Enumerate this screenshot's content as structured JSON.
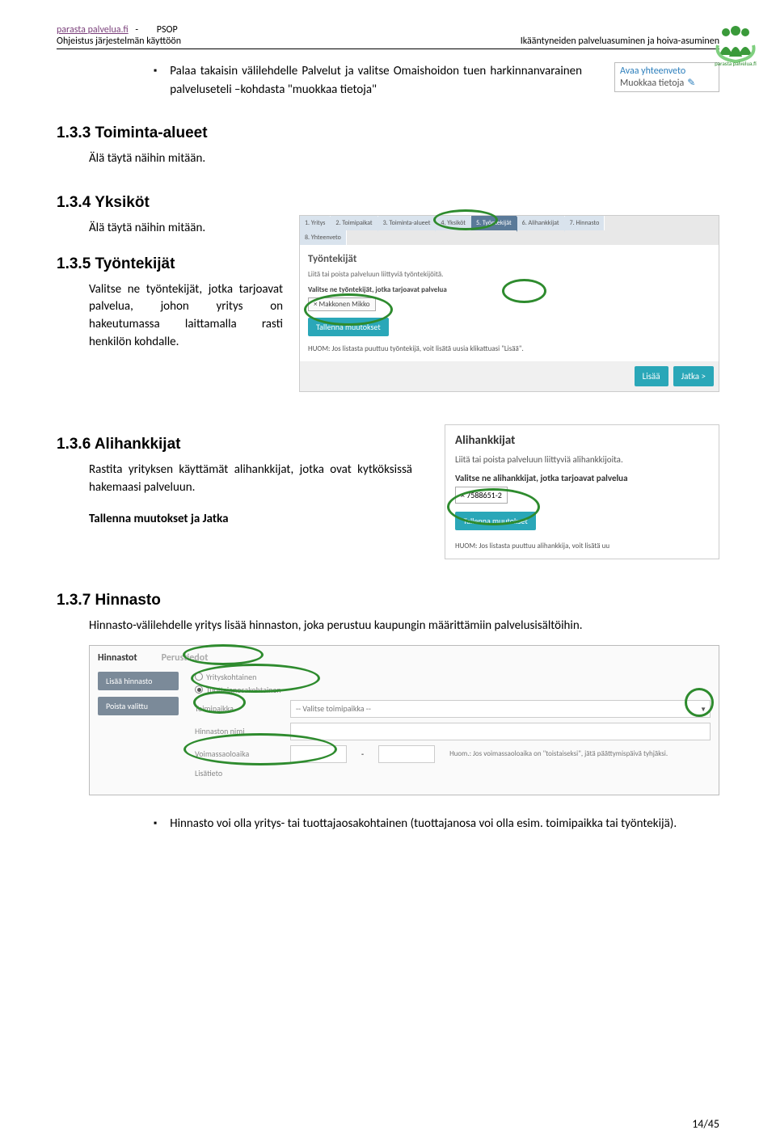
{
  "header": {
    "site": "parasta palvelua.fi",
    "dash": "-",
    "psop": "PSOP",
    "line2": "Ohjeistus järjestelmän käyttöön",
    "right": "Ikääntyneiden palveluasuminen ja hoiva-asuminen"
  },
  "logo_text": "parasta palvelua.fi",
  "bullet1": "Palaa takaisin välilehdelle Palvelut ja valitse Omaishoidon tuen harkinnanvarainen palveluseteli –kohdasta \"muokkaa tietoja\"",
  "popup": {
    "l1": "Avaa yhteenveto",
    "l2": "Muokkaa tietoja"
  },
  "s133": {
    "h": "1.3.3 Toiminta-alueet",
    "p": "Älä täytä näihin mitään."
  },
  "s134": {
    "h": "1.3.4 Yksiköt",
    "p": "Älä täytä näihin mitään."
  },
  "s135": {
    "h": "1.3.5 Työntekijät",
    "p": "Valitse ne työntekijät, jotka tarjoavat palvelua, johon yritys on hakeutumassa laittamalla rasti henkilön kohdalle."
  },
  "shot_t": {
    "tabs": [
      "1. Yritys",
      "2. Toimipaikat",
      "3. Toiminta-alueet",
      "4. Yksiköt",
      "5. Työntekijät",
      "6. Alihankkijat",
      "7. Hinnasto"
    ],
    "tab8": "8. Yhteenveto",
    "h": "Työntekijät",
    "sub": "Liitä tai poista palveluun liittyviä työntekijöitä.",
    "bold": "Valitse ne työntekijät, jotka tarjoavat palvelua",
    "chip": "× Makkonen Mikko",
    "btn": "Tallenna muutokset",
    "note": "HUOM: Jos listasta puuttuu työntekijä, voit lisätä uusia klikattuasi \"Lisää\".",
    "foot1": "Lisää",
    "foot2": "Jatka >"
  },
  "s136": {
    "h": "1.3.6 Alihankkijat",
    "p": "Rastita yrityksen käyttämät alihankkijat, jotka ovat kytköksissä hakemaasi palveluun.",
    "p2": "Tallenna muutokset ja Jatka"
  },
  "shot_a": {
    "h": "Alihankkijat",
    "p": "Liitä tai poista palveluun liittyviä alihankkijoita.",
    "b": "Valitse ne alihankkijat, jotka tarjoavat palvelua",
    "chip": "× 7588651-2",
    "btn": "Tallenna muutokset",
    "note": "HUOM: Jos listasta puuttuu alihankkija, voit lisätä uu"
  },
  "s137": {
    "h": "1.3.7 Hinnasto",
    "p": "Hinnasto-välilehdelle yritys lisää hinnaston, joka perustuu kaupungin määrittämiin palvelusisältöihin."
  },
  "shot_h": {
    "tab1": "Hinnastot",
    "tab2": "Perustiedot",
    "btn_add": "Lisää hinnasto",
    "btn_del": "Poista valittu",
    "r1a": "Yrityskohtainen",
    "r1b": "Tuottajanosakohtainen",
    "l_toimi": "Toimipaikka",
    "v_toimi": "-- Valitse toimipaikka --",
    "l_nimi": "Hinnaston nimi",
    "l_voim": "Voimassaoloaika",
    "dash": "-",
    "huom": "Huom.: Jos voimassaoloaika on \"toistaiseksi\", jätä päättymispäivä tyhjäksi.",
    "l_lisa": "Lisätieto"
  },
  "bullet2": "Hinnasto voi olla yritys- tai tuottajaosakohtainen (tuottajanosa voi olla esim. toimipaikka tai työntekijä).",
  "page_num": "14/45"
}
